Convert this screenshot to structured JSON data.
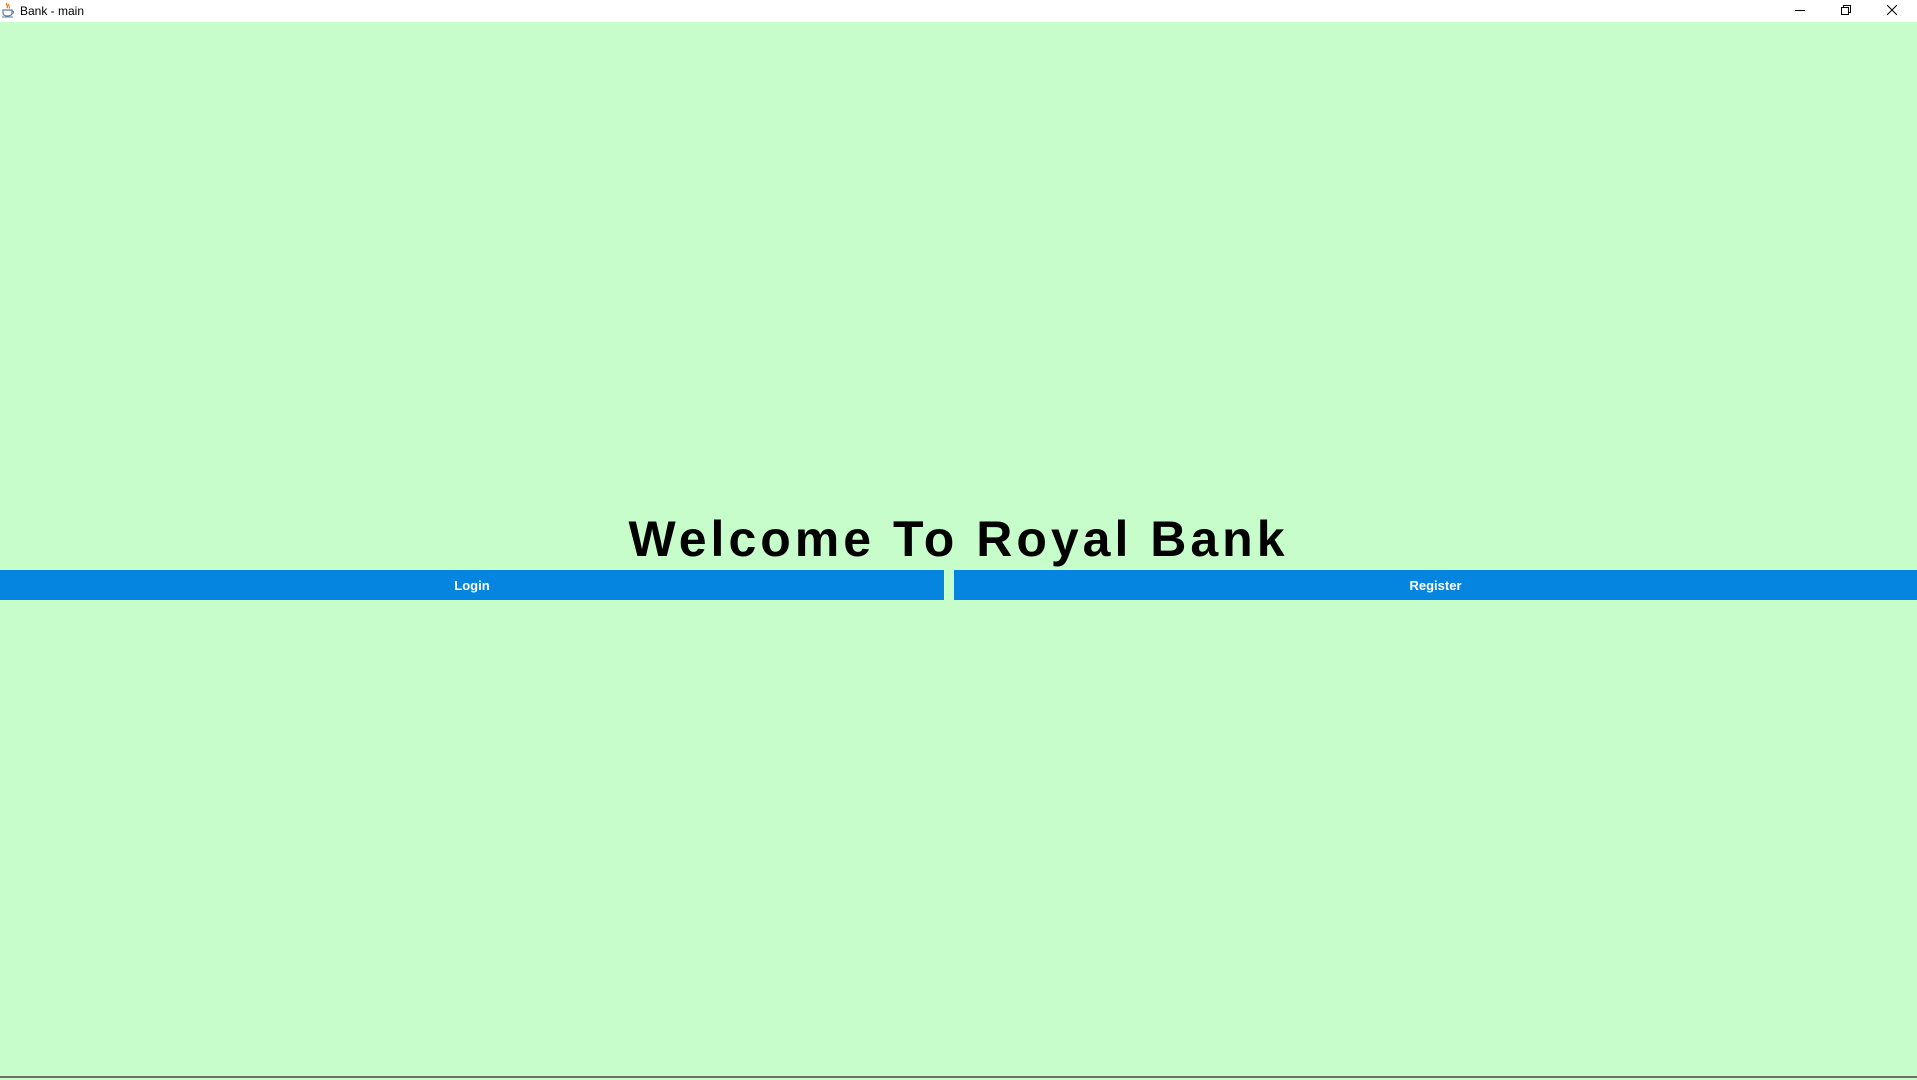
{
  "window": {
    "title": "Bank - main",
    "icons": {
      "app": "java-cup-icon",
      "minimize": "minimize-icon",
      "maximize": "restore-icon",
      "close": "close-icon"
    }
  },
  "main": {
    "heading": "Welcome To Royal Bank",
    "login_label": "Login",
    "register_label": "Register"
  },
  "colors": {
    "background": "#c6fdca",
    "button": "#0584e0",
    "button_text": "#ffffff",
    "heading": "#000000"
  }
}
